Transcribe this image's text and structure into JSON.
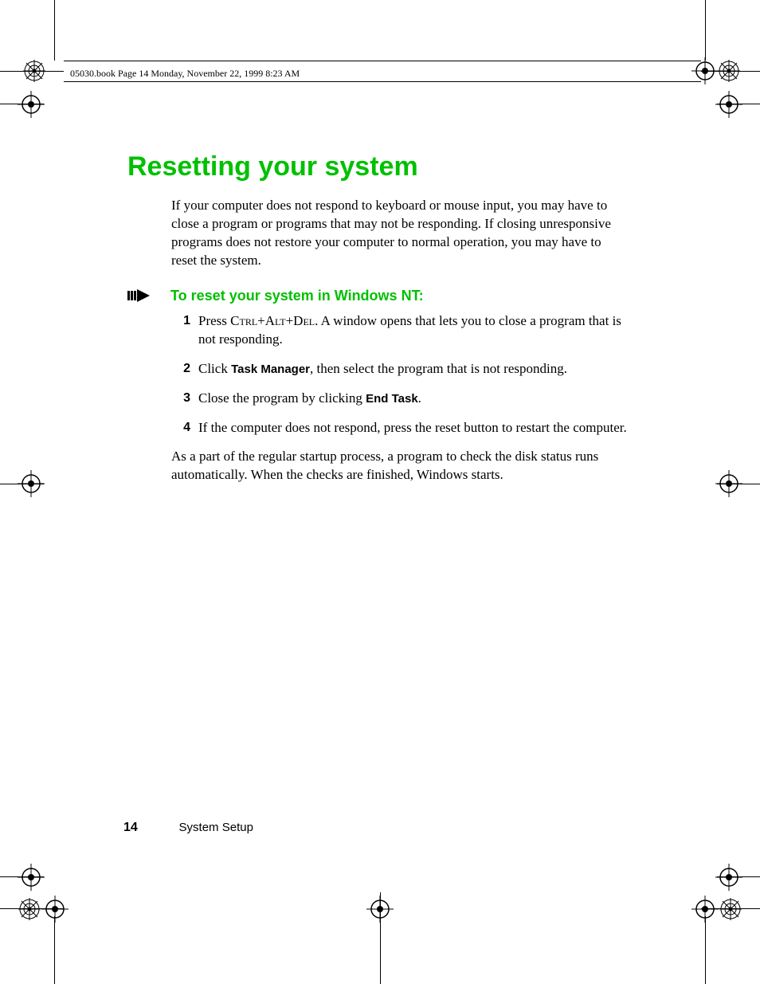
{
  "meta": {
    "header": "05030.book  Page 14  Monday, November 22, 1999  8:23 AM"
  },
  "title": "Resetting your system",
  "intro": "If your computer does not respond to keyboard or mouse input, you may have to close a program or programs that may not be responding. If closing unresponsive programs does not restore your computer to normal operation, you may have to reset the system.",
  "subhead": "To reset your system in Windows NT:",
  "steps": {
    "s1_a": "Press ",
    "s1_keys": "Ctrl+Alt+Del",
    "s1_b": ". A window opens that lets you to close a program that is not responding.",
    "s2_a": "Click ",
    "s2_ui": "Task Manager",
    "s2_b": ", then select the program that is not responding.",
    "s3_a": "Close the program by clicking ",
    "s3_ui": "End Task",
    "s3_b": ".",
    "s4": "If the computer does not respond, press the reset button to restart the computer."
  },
  "nums": {
    "n1": "1",
    "n2": "2",
    "n3": "3",
    "n4": "4"
  },
  "outro": "As a part of the regular startup process, a program to check the disk status runs automatically. When the checks are finished, Windows starts.",
  "footer": {
    "page": "14",
    "section": "System Setup"
  }
}
